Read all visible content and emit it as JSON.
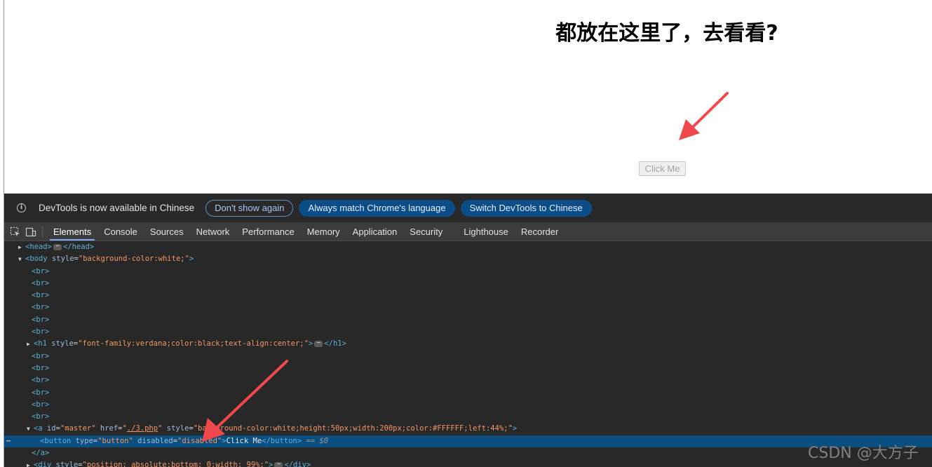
{
  "page": {
    "heading": "都放在这里了，去看看?",
    "button_label": "Click Me"
  },
  "infobar": {
    "message": "DevTools is now available in Chinese",
    "dont_show": "Don't show again",
    "always_match": "Always match Chrome's language",
    "switch": "Switch DevTools to Chinese"
  },
  "tabs": [
    "Elements",
    "Console",
    "Sources",
    "Network",
    "Performance",
    "Memory",
    "Application",
    "Security",
    "Lighthouse",
    "Recorder"
  ],
  "active_tab": "Elements",
  "dom": {
    "head_open": "<head>",
    "head_close": "</head>",
    "body_open": "<body",
    "body_style_attr": "style",
    "body_style_val": "\"background-color:white;\"",
    "br": "<br>",
    "h1_open": "<h1",
    "h1_style_attr": "style",
    "h1_style_val": "\"font-family:verdana;color:black;text-align:center;\"",
    "h1_close": "</h1>",
    "a_open": "<a",
    "a_id_attr": "id",
    "a_id_val": "\"master\"",
    "a_href_attr": "href",
    "a_href_val": "./3.php",
    "a_style_attr": "style",
    "a_style_val": "\"background-color:white;height:50px;width:200px;color:#FFFFFF;left:44%;\"",
    "button_open": "<button",
    "button_type_attr": "type",
    "button_type_val": "\"button\"",
    "button_disabled_attr": "disabled",
    "button_disabled_val": "\"disabled\"",
    "button_text": "Click Me",
    "button_close": "</button>",
    "dollar": "== $0",
    "a_close": "</a>",
    "div_open": "<div",
    "div_style_attr": "style",
    "div_style_val": "\"position: absolute;bottom: 0;width: 99%;\"",
    "div_close": "</div>",
    "ellipsis": "⋯",
    "gt": ">"
  },
  "watermark": "CSDN @大方子",
  "colors": {
    "arrow": "#f0484c",
    "selected_row": "#0b4f80",
    "tag": "#5db0d7",
    "attr_name": "#9bbbdc",
    "attr_value": "#f29766"
  },
  "icons": [
    "info-icon",
    "inspect-element-icon",
    "device-toolbar-icon",
    "expand-triangle-icon",
    "collapse-triangle-icon",
    "ellipsis-icon",
    "arrow-annotation-icon"
  ]
}
